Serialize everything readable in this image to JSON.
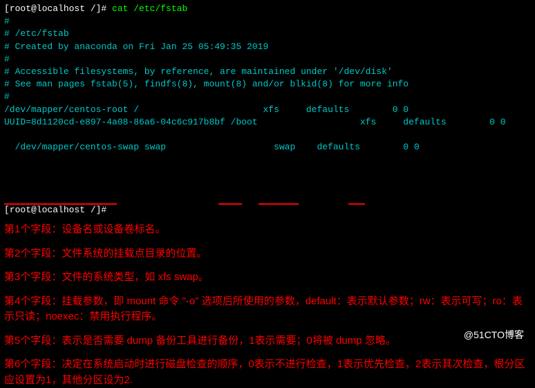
{
  "prompt1": {
    "user_host": "[root@localhost /]#",
    "command": " cat /etc/fstab"
  },
  "fstab": {
    "l1": "#",
    "l2": "# /etc/fstab",
    "l3": "# Created by anaconda on Fri Jan 25 05:49:35 2019",
    "l4": "#",
    "l5": "# Accessible filesystems, by reference, are maintained under '/dev/disk'",
    "l6": "# See man pages fstab(5), findfs(8), mount(8) and/or blkid(8) for more info",
    "l7": "#",
    "l8": "/dev/mapper/centos-root /                       xfs     defaults        0 0",
    "l9": "UUID=8d1120cd-e897-4a08-86a6-04c6c917b8bf /boot                   xfs     defaults        0 0",
    "l10": "/dev/mapper/centos-swap swap                    swap    defaults        0 0"
  },
  "prompt2": {
    "user_host": "[root@localhost /]#",
    "cursor": " "
  },
  "annotations": {
    "f1": "第1个字段：设备名或设备卷标名。",
    "f2": "第2个字段：文件系统的挂载点目录的位置。",
    "f3": "第3个字段：文件的系统类型，如 xfs  swap。",
    "f4": "第4个字段：挂载参数，即 mount 命令 \"-o\" 选项后所使用的参数，default：表示默认参数；rw：表示可写；ro：表示只读；noexec：禁用执行程序。",
    "f5": "第5个字段：表示是否需要 dump 备份工具进行备份，1表示需要；0将被 dump 忽略。",
    "f6": "第6个字段：决定在系统启动时进行磁盘检查的顺序，0表示不进行检查，1表示优先检查，2表示其次检查，根分区应设置为1，其他分区设为2."
  },
  "watermark": "@51CTO博客"
}
